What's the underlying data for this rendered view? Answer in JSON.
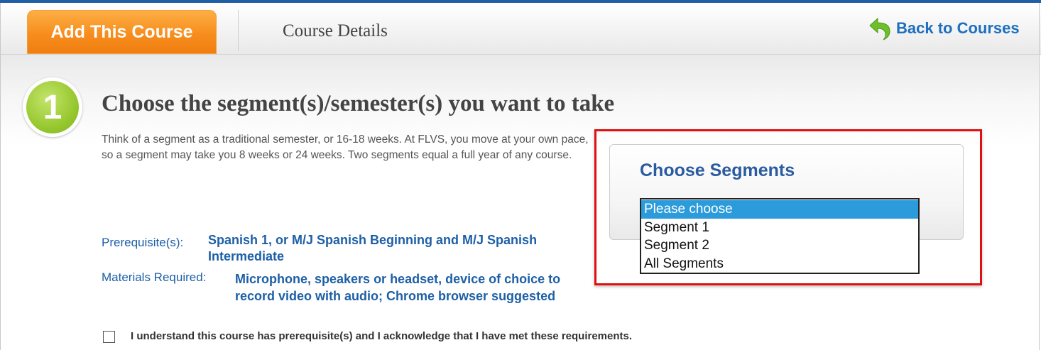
{
  "header": {
    "add_course_tab": "Add This Course",
    "course_details_tab": "Course Details",
    "back_to_courses": "Back to Courses"
  },
  "step": {
    "number": "1",
    "title": "Choose the segment(s)/semester(s) you want to take",
    "description": "Think of a segment as a traditional semester, or 16-18 weeks. At FLVS, you move at your own pace, so a segment may take you 8 weeks or 24 weeks. Two segments equal a full year of any course."
  },
  "requirements": {
    "prerequisites_label": "Prerequisite(s):",
    "prerequisites_value": "Spanish 1, or M/J Spanish Beginning and M/J Spanish Intermediate",
    "materials_label": "Materials Required:",
    "materials_value": "Microphone, speakers or headset, device of choice to record video with audio; Chrome browser suggested"
  },
  "segments": {
    "title": "Choose Segments",
    "options": [
      "Please choose",
      "Segment 1",
      "Segment 2",
      "All Segments"
    ],
    "selected": "Please choose"
  },
  "acknowledgement": {
    "label": "I understand this course has prerequisite(s) and I acknowledge that I have met these requirements.",
    "checked": false
  },
  "colors": {
    "accent_orange": "#f78d1e",
    "link_blue": "#1d6fbf",
    "step_green": "#94c62c",
    "selection_blue": "#2b9bdb",
    "highlight_red": "#e01010"
  }
}
